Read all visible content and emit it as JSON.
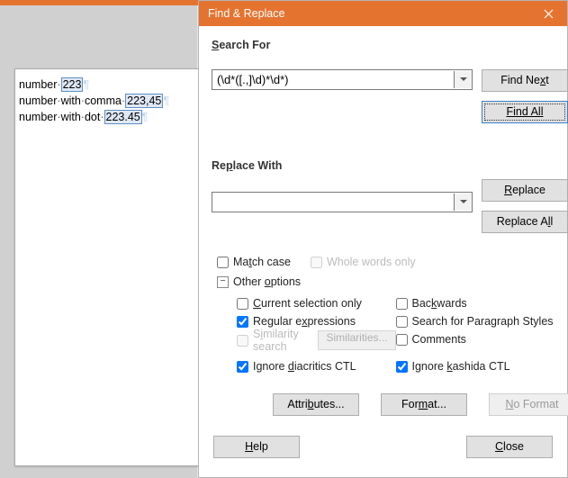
{
  "document": {
    "line1_prefix": "number",
    "line1_match": "223",
    "line2_prefix": "number",
    "line2_mid": "with",
    "line2_mid2": "comma",
    "line2_match": "223,45",
    "line3_prefix": "number",
    "line3_mid": "with",
    "line3_mid2": "dot",
    "line3_match": "223.45"
  },
  "dialog": {
    "title": "Find & Replace",
    "search_label_pre": "S",
    "search_label_post": "earch For",
    "search_value": "(\\d*([.,]\\d)*\\d*)",
    "replace_label_pre": "Re",
    "replace_label_u": "p",
    "replace_label_post": "lace With",
    "replace_value": ""
  },
  "buttons": {
    "find_next_pre": "Find Ne",
    "find_next_u": "x",
    "find_next_post": "t",
    "find_all": "Find All",
    "replace_u": "R",
    "replace_post": "eplace",
    "replace_all_pre": "Replace A",
    "replace_all_u": "l",
    "replace_all_post": "l",
    "attributes_pre": "Attri",
    "attributes_u": "b",
    "attributes_post": "utes...",
    "format_pre": "For",
    "format_u": "m",
    "format_post": "at...",
    "noformat_u": "N",
    "noformat_post": "o Format",
    "help_u": "H",
    "help_post": "elp",
    "close_u": "C",
    "close_post": "lose"
  },
  "options": {
    "match_case_pre": "Ma",
    "match_case_u": "t",
    "match_case_post": "ch case",
    "whole_words": "Whole words only",
    "other_pre": "Other ",
    "other_u": "o",
    "other_post": "ptions",
    "cur_sel_u": "C",
    "cur_sel_post": "urrent selection only",
    "backwards_pre": "Bac",
    "backwards_u": "k",
    "backwards_post": "wards",
    "regex_pre": "Regular e",
    "regex_u": "x",
    "regex_post": "pressions",
    "para_styles_pre": "Search for Para",
    "para_styles_u": "g",
    "para_styles_post": "raph Styles",
    "similarity_pre": "S",
    "similarity_u": "i",
    "similarity_post": "milarity search",
    "similarities_btn": "Similarities...",
    "comments": "Comments",
    "diacritics_pre": "Ignore ",
    "diacritics_u": "d",
    "diacritics_post": "iacritics CTL",
    "kashida_pre": "Ignore ",
    "kashida_u": "k",
    "kashida_post": "ashida CTL"
  },
  "state": {
    "match_case": false,
    "whole_words": false,
    "current_selection": false,
    "backwards": false,
    "regex": true,
    "para_styles": false,
    "similarity": false,
    "comments": false,
    "diacritics": true,
    "kashida": true
  }
}
